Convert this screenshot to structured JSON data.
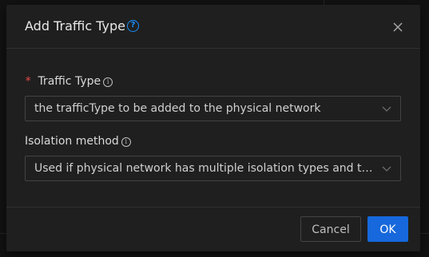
{
  "dialog": {
    "title": "Add Traffic Type",
    "help_icon": "question-circle-icon",
    "close_icon": "close-icon"
  },
  "form": {
    "traffic_type": {
      "required_mark": "*",
      "label": "Traffic Type",
      "info_icon": "info-circle-icon",
      "placeholder": "the trafficType to be added to the physical network"
    },
    "isolation_method": {
      "label": "Isolation method",
      "info_icon": "info-circle-icon",
      "placeholder": "Used if physical network has multiple isolation types and traffic type is public. Choose Vlan or vxlan"
    }
  },
  "footer": {
    "cancel_label": "Cancel",
    "ok_label": "OK"
  },
  "colors": {
    "primary": "#1668dc",
    "required": "#e84749",
    "help": "#1890ff",
    "modal_bg": "#1f1f1f"
  }
}
